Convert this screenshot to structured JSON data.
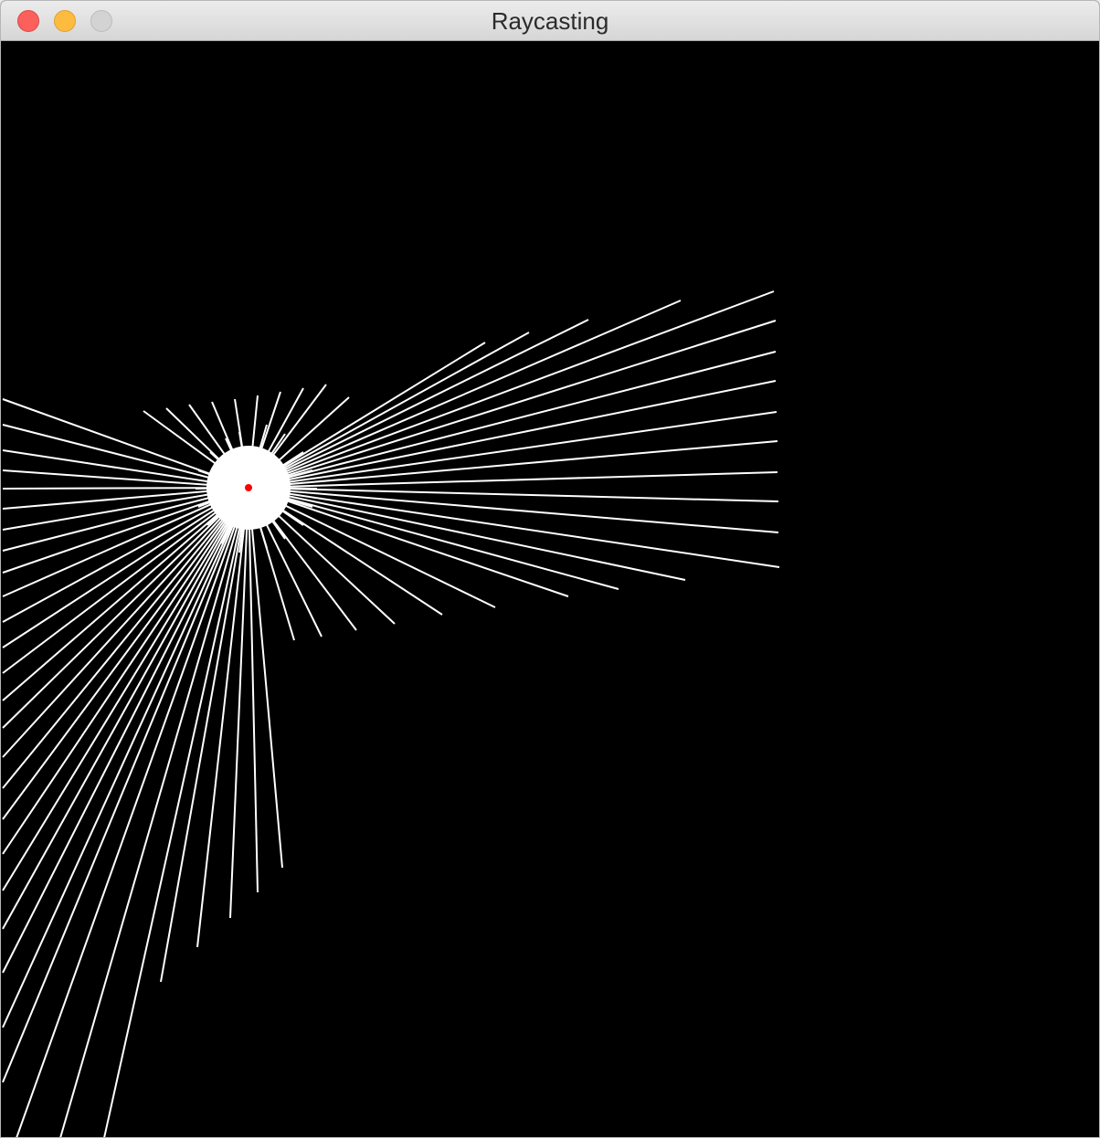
{
  "window": {
    "title": "Raycasting",
    "controls": [
      "close",
      "minimize",
      "zoom"
    ]
  },
  "scene": {
    "background_color": "#000000",
    "ray_color": "#ffffff",
    "source_color": "#ff0000",
    "source_icon": "light-source-dot"
  }
}
